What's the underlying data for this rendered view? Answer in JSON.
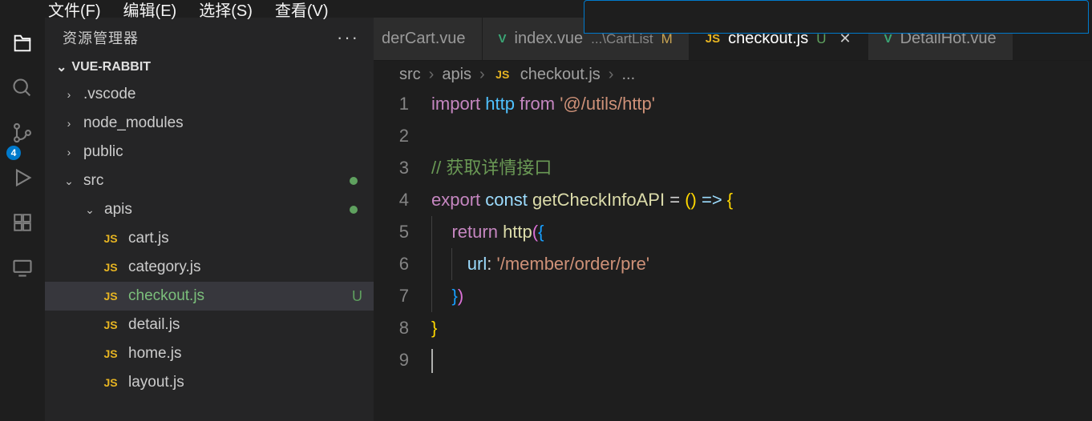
{
  "menu": {
    "file": "文件(F)",
    "edit": "编辑(E)",
    "select": "选择(S)",
    "view": "查看(V)"
  },
  "sidebar": {
    "title": "资源管理器",
    "project": "VUE-RABBIT",
    "tree": [
      {
        "name": ".vscode",
        "kind": "folder",
        "open": false
      },
      {
        "name": "node_modules",
        "kind": "folder",
        "open": false
      },
      {
        "name": "public",
        "kind": "folder",
        "open": false
      },
      {
        "name": "src",
        "kind": "folder",
        "open": true,
        "modified": true
      },
      {
        "name": "apis",
        "kind": "folder",
        "open": true,
        "indent": 1,
        "modified": true
      },
      {
        "name": "cart.js",
        "kind": "js",
        "indent": 2
      },
      {
        "name": "category.js",
        "kind": "js",
        "indent": 2
      },
      {
        "name": "checkout.js",
        "kind": "js",
        "indent": 2,
        "selected": true,
        "status": "U",
        "green": true
      },
      {
        "name": "detail.js",
        "kind": "js",
        "indent": 2
      },
      {
        "name": "home.js",
        "kind": "js",
        "indent": 2
      },
      {
        "name": "layout.js",
        "kind": "js",
        "indent": 2
      }
    ]
  },
  "activity": {
    "scm_badge": "4"
  },
  "tabs": [
    {
      "label": "derCart.vue",
      "icon": "",
      "cut": true
    },
    {
      "label": "index.vue",
      "icon": "vue",
      "suffix": "...\\CartList",
      "status": "M"
    },
    {
      "label": "checkout.js",
      "icon": "js",
      "status": "U",
      "active": true,
      "close": true
    },
    {
      "label": "DetailHot.vue",
      "icon": "vue"
    }
  ],
  "breadcrumb": {
    "parts": [
      "src",
      "apis"
    ],
    "file": "checkout.js",
    "tail": "..."
  },
  "code": {
    "lines": 9,
    "l1_import": "import",
    "l1_http": "http",
    "l1_from": "from",
    "l1_path": "'@/utils/http'",
    "l3_comment": "// 获取详情接口",
    "l4_export": "export",
    "l4_const": "const",
    "l4_fn": "getCheckInfoAPI",
    "l4_arrow": " = () => {",
    "l5_return": "return",
    "l5_call": "http",
    "l5_open": "({",
    "l6_key": "url",
    "l6_colon": ":",
    "l6_val": "'/member/order/pre'",
    "l7_close": "})",
    "l8_brace": "}"
  }
}
